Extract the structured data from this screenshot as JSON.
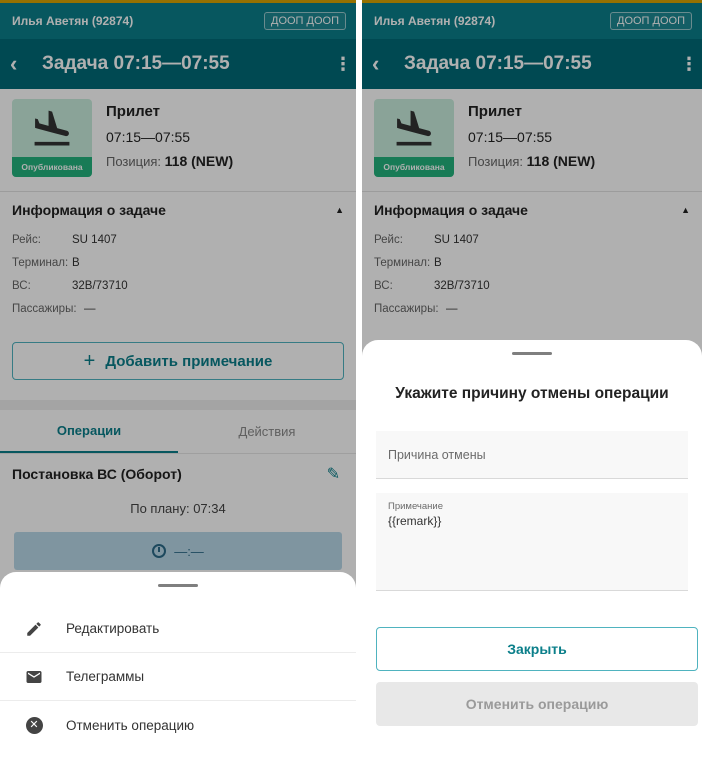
{
  "colors": {
    "primary": "#006a77",
    "status_bar": "#0b7f8a",
    "published_badge": "#23b27d",
    "accent_line": "#d9a400"
  },
  "header": {
    "user": "Илья Аветян (92874)",
    "org": "ДООП ДООП",
    "title": "Задача 07:15—07:55",
    "back_icon": "chevron-left-icon",
    "menu_icon": "more-vertical-icon"
  },
  "task": {
    "type": "Прилет",
    "time": "07:15—07:55",
    "position_label": "Позиция:",
    "position_value": "118 (NEW)",
    "status": "Опубликована",
    "icon": "airplane-landing-icon"
  },
  "info": {
    "title": "Информация о задаче",
    "rows": [
      {
        "label": "Рейс:",
        "value": "SU 1407"
      },
      {
        "label": "Терминал:",
        "value": "B"
      },
      {
        "label": "ВС:",
        "value": "32B/73710"
      },
      {
        "label": "Пассажиры:",
        "value": "—"
      }
    ]
  },
  "add_note_label": "Добавить примечание",
  "tabs": [
    "Операции",
    "Действия"
  ],
  "operation": {
    "title": "Постановка ВС (Оборот)",
    "plan": "По плану: 07:34",
    "actual": "—:—"
  },
  "actions_sheet": {
    "items": [
      {
        "label": "Редактировать",
        "icon": "pencil-icon"
      },
      {
        "label": "Телеграммы",
        "icon": "mail-icon"
      },
      {
        "label": "Отменить операцию",
        "icon": "cancel-circle-icon"
      }
    ]
  },
  "cancel_sheet": {
    "title": "Укажите причину отмены операции",
    "reason_placeholder": "Причина отмены",
    "note_label": "Примечание",
    "note_value": "{{remark}}",
    "close_label": "Закрыть",
    "submit_label": "Отменить операцию"
  }
}
